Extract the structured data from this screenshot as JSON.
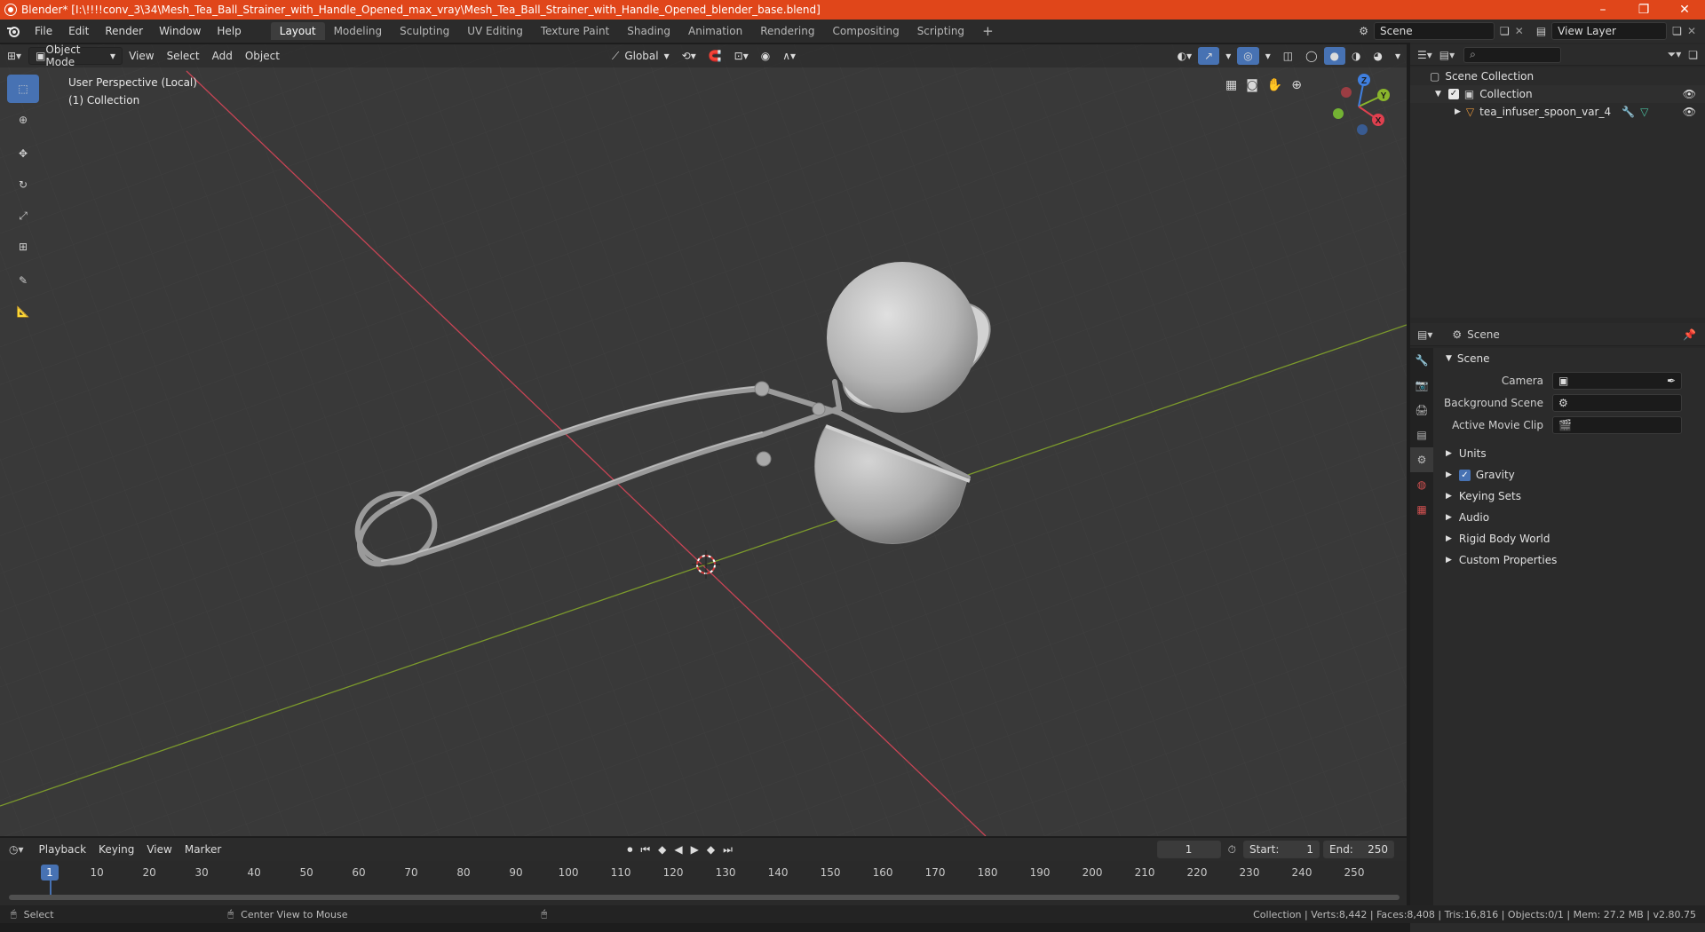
{
  "window": {
    "title": "Blender* [I:\\!!!!conv_3\\34\\Mesh_Tea_Ball_Strainer_with_Handle_Opened_max_vray\\Mesh_Tea_Ball_Strainer_with_Handle_Opened_blender_base.blend]",
    "minimize": "–",
    "restore": "❐",
    "close": "✕"
  },
  "menus": [
    "File",
    "Edit",
    "Render",
    "Window",
    "Help"
  ],
  "workspaces": [
    "Layout",
    "Modeling",
    "Sculpting",
    "UV Editing",
    "Texture Paint",
    "Shading",
    "Animation",
    "Rendering",
    "Compositing",
    "Scripting"
  ],
  "active_workspace": "Layout",
  "add_workspace": "+",
  "scene_field": "Scene",
  "viewlayer_field": "View Layer",
  "viewport": {
    "mode": "Object Mode",
    "menus": [
      "View",
      "Select",
      "Add",
      "Object"
    ],
    "transform_orientation": "Global",
    "overlay_line1": "User Perspective (Local)",
    "overlay_line2": "(1) Collection",
    "gizmo_axes": {
      "x": "X",
      "y": "Y",
      "z": "Z"
    }
  },
  "outliner": {
    "root": "Scene Collection",
    "collection": "Collection",
    "object": "tea_infuser_spoon_var_4"
  },
  "properties": {
    "header": "Scene",
    "section": "Scene",
    "fields": [
      {
        "label": "Camera",
        "value": ""
      },
      {
        "label": "Background Scene",
        "value": ""
      },
      {
        "label": "Active Movie Clip",
        "value": ""
      }
    ],
    "subsections": [
      "Units",
      "Gravity",
      "Keying Sets",
      "Audio",
      "Rigid Body World",
      "Custom Properties"
    ],
    "gravity_checked": true
  },
  "timeline": {
    "menus": [
      "Playback",
      "Keying",
      "View",
      "Marker"
    ],
    "current_frame": "1",
    "start_label": "Start:",
    "start": "1",
    "end_label": "End:",
    "end": "250",
    "ticks": [
      "1",
      "10",
      "20",
      "30",
      "40",
      "50",
      "60",
      "70",
      "80",
      "90",
      "100",
      "110",
      "120",
      "130",
      "140",
      "150",
      "160",
      "170",
      "180",
      "190",
      "200",
      "210",
      "220",
      "230",
      "240",
      "250"
    ]
  },
  "status": {
    "left_action": "Select",
    "middle_action": "Center View to Mouse",
    "right_info": "Collection | Verts:8,442 | Faces:8,408 | Tris:16,816 | Objects:0/1 | Mem: 27.2 MB | v2.80.75"
  },
  "colors": {
    "titlebar": "#e0461a",
    "accent": "#4772b3",
    "x_axis": "#e0404f",
    "y_axis": "#8ab52c",
    "z_axis": "#3f7fe0"
  }
}
